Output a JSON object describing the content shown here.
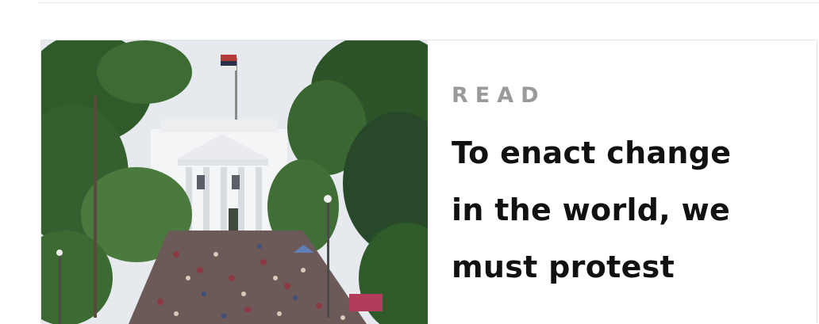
{
  "card": {
    "kicker": "READ",
    "headline": "To enact change in the world, we must protest",
    "image_alt": "Crowd of protesters on a street in front of the White House"
  },
  "colors": {
    "kicker": "#9a9a9a",
    "headline": "#111111",
    "border": "#e3e3e3"
  }
}
